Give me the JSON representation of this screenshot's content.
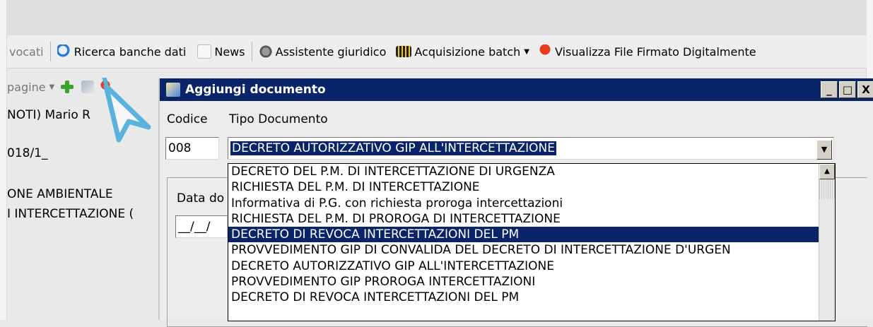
{
  "toolbar": {
    "items": [
      {
        "label": "vocati"
      },
      {
        "label": "Ricerca banche dati"
      },
      {
        "label": "News"
      },
      {
        "label": "Assistente giuridico"
      },
      {
        "label": "Acquisizione batch"
      },
      {
        "label": "Visualizza File Firmato Digitalmente"
      }
    ]
  },
  "subtoolbar": {
    "pages_label": "pagine"
  },
  "left_panel": {
    "lines": [
      "NOTI) Mario R",
      "018/1_",
      "ONE AMBIENTALE",
      "I INTERCETTAZIONE ("
    ]
  },
  "dialog": {
    "title": "Aggiungi documento",
    "controls": {
      "minimize": "_",
      "maximize": "□",
      "close": "X"
    },
    "codice_label": "Codice",
    "tipo_label": "Tipo Documento",
    "codice_value": "008",
    "tipo_value": "DECRETO AUTORIZZATIVO GIP ALL'INTERCETTAZIONE",
    "data_label": "Data do",
    "date_value": "__/__/",
    "dropdown_options": [
      "DECRETO DEL P.M. DI INTERCETTAZIONE DI URGENZA",
      "RICHIESTA DEL P.M. DI INTERCETTAZIONE",
      "Informativa di P.G. con richiesta  proroga intercettazioni",
      "RICHIESTA DEL P.M. DI PROROGA DI INTERCETTAZIONE",
      "DECRETO DI REVOCA INTERCETTAZIONI DEL PM",
      "PROVVEDIMENTO GIP DI CONVALIDA DEL DECRETO DI INTERCETTAZIONE D'URGEN",
      "DECRETO AUTORIZZATIVO GIP ALL'INTERCETTAZIONE",
      "PROVVEDIMENTO GIP PROROGA INTERCETTAZIONI",
      "DECRETO DI REVOCA INTERCETTAZIONI DEL PM"
    ],
    "selected_option": "DECRETO DI REVOCA INTERCETTAZIONI DEL PM"
  },
  "colors": {
    "titlebar": "#0a246a",
    "selection": "#0a246a"
  }
}
